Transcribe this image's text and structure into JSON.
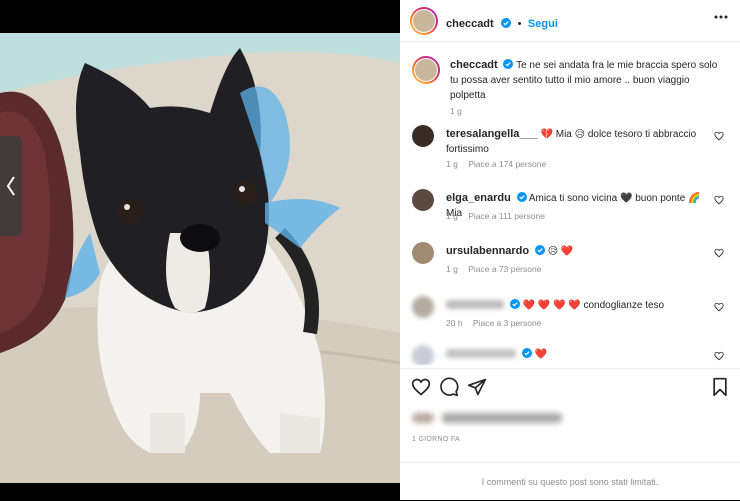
{
  "post": {
    "username": "checcadt",
    "follow_label": "Segui",
    "caption": "Te ne sei andata fra le mie braccia spero solo tu possa aver sentito tutto il mio amore .. buon viaggio polpetta",
    "caption_time": "1 g"
  },
  "comments": [
    {
      "username": "teresalangella___",
      "verified": false,
      "text": "💔 Mia 😥 dolce tesoro ti abbraccio fortissimo",
      "time": "1 g",
      "likes": "Piace a 174 persone"
    },
    {
      "username": "elga_enardu",
      "verified": true,
      "text": "Amica ti sono vicina 🖤 buon ponte 🌈 Mia",
      "time": "1 g",
      "likes": "Piace a 111 persone"
    },
    {
      "username": "ursulabennardo",
      "verified": true,
      "text": "😥 ❤️",
      "time": "1 g",
      "likes": "Piace a 73 persone"
    },
    {
      "username": "",
      "verified": true,
      "text": "❤️ ❤️ ❤️ ❤️ condoglianze teso",
      "time": "20 h",
      "likes": "Piace a 3 persone"
    },
    {
      "username": "",
      "verified": false,
      "text": "❤️",
      "time": "",
      "likes": ""
    }
  ],
  "footer": {
    "timestamp": "1 GIORNO FA",
    "comments_limited": "I commenti su questo post sono stati limitati."
  },
  "colors": {
    "accent": "#0095f6",
    "like_heart": "#ed4956"
  }
}
